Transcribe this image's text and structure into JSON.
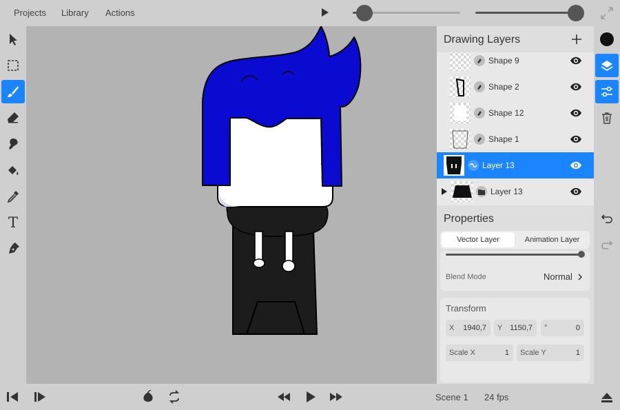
{
  "menu": {
    "projects": "Projects",
    "library": "Library",
    "actions": "Actions"
  },
  "top_sliders": [
    {
      "name": "timeline-scrubber",
      "value": 0.12
    },
    {
      "name": "zoom-slider",
      "value": 1.0
    }
  ],
  "tools": [
    "select-icon",
    "marquee-icon",
    "brush-icon",
    "eraser-icon",
    "smudge-icon",
    "fill-icon",
    "eyedropper-icon",
    "text-icon",
    "pen-icon"
  ],
  "active_tool": "brush-icon",
  "text_tool_glyph": "T",
  "layers_panel": {
    "title": "Drawing Layers",
    "add_icon": "plus-icon",
    "layers": [
      {
        "name": "Shape 9",
        "type": "vector",
        "visible": true
      },
      {
        "name": "Shape 2",
        "type": "vector",
        "visible": true
      },
      {
        "name": "Shape 12",
        "type": "vector",
        "visible": true
      },
      {
        "name": "Shape 1",
        "type": "vector",
        "visible": true
      },
      {
        "name": "Layer 13",
        "type": "animation",
        "visible": true,
        "selected": true
      },
      {
        "name": "Layer 13",
        "type": "group",
        "visible": true
      }
    ]
  },
  "properties": {
    "title": "Properties",
    "tabs": [
      "Vector Layer",
      "Animation Layer"
    ],
    "active_tab": "Vector Layer",
    "opacity": 1.0,
    "blend_mode_label": "Blend Mode",
    "blend_mode_value": "Normal",
    "transform_title": "Transform",
    "x_label": "X",
    "x_value": "1940,7",
    "y_label": "Y",
    "y_value": "1150,7",
    "rotation_label": "°",
    "rotation_value": "0",
    "scale_x_label": "Scale X",
    "scale_x_value": "1",
    "scale_y_label": "Scale Y",
    "scale_y_value": "1"
  },
  "bottom": {
    "scene": "Scene 1",
    "fps": "24 fps"
  },
  "colors": {
    "accent": "#1a85ff",
    "hair": "#0a0ad0",
    "current_color": "#111111"
  }
}
